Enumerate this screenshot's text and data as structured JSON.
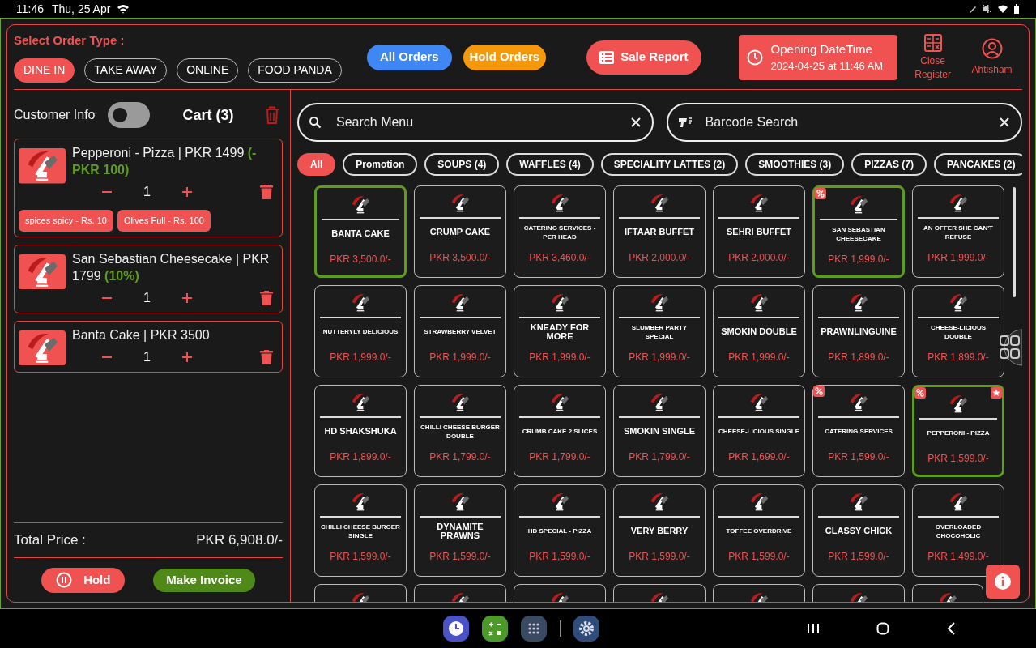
{
  "status_bar": {
    "time": "11:46",
    "date": "Thu, 25 Apr"
  },
  "header": {
    "order_type_label": "Select Order Type :",
    "order_types": [
      {
        "label": "DINE IN",
        "selected": true
      },
      {
        "label": "TAKE AWAY",
        "selected": false
      },
      {
        "label": "ONLINE",
        "selected": false
      },
      {
        "label": "FOOD PANDA",
        "selected": false
      }
    ],
    "all_orders": "All Orders",
    "hold_orders": "Hold Orders",
    "sale_report": "Sale Report",
    "opening": {
      "title": "Opening DateTime",
      "value": "2024-04-25 at 11:46 AM"
    },
    "close_register": "Close Register",
    "user": "Ahtisham"
  },
  "cart": {
    "customer_info": "Customer Info",
    "customer_info_on": false,
    "title": "Cart (3)",
    "items": [
      {
        "name": "Pepperoni - Pizza | PKR 1499",
        "discount": "(- PKR 100)",
        "qty": "1",
        "addons": [
          "spices spicy - Rs. 10",
          "Olives Full - Rs. 100"
        ]
      },
      {
        "name": "San Sebastian Cheesecake | PKR 1799",
        "discount": "(10%)",
        "qty": "1"
      },
      {
        "name": "Banta Cake | PKR 3500",
        "qty": "1"
      }
    ],
    "total_label": "Total Price :",
    "total": "PKR 6,908.0/-",
    "hold": "Hold",
    "invoice": "Make Invoice"
  },
  "menu": {
    "search_placeholder": "Search Menu",
    "barcode_placeholder": "Barcode Search",
    "categories": [
      {
        "label": "All",
        "selected": true
      },
      {
        "label": "Promotion",
        "selected": false
      },
      {
        "label": "SOUPS (4)",
        "selected": false
      },
      {
        "label": "WAFFLES (4)",
        "selected": false
      },
      {
        "label": "SPECIALITY LATTES (2)",
        "selected": false
      },
      {
        "label": "SMOOTHIES (3)",
        "selected": false
      },
      {
        "label": "PIZZAS (7)",
        "selected": false
      },
      {
        "label": "PANCAKES (2)",
        "selected": false
      }
    ],
    "items": [
      {
        "name": "BANTA CAKE",
        "price": "PKR 3,500.0/-",
        "selected": true,
        "discount": false,
        "favorite": false
      },
      {
        "name": "CRUMP CAKE",
        "price": "PKR 3,500.0/-",
        "selected": false,
        "discount": false,
        "favorite": false
      },
      {
        "name": "CATERING SERVICES - PER HEAD",
        "price": "PKR 3,460.0/-",
        "selected": false,
        "discount": false,
        "favorite": false
      },
      {
        "name": "IFTAAR BUFFET",
        "price": "PKR 2,000.0/-",
        "selected": false,
        "discount": false,
        "favorite": false
      },
      {
        "name": "SEHRI BUFFET",
        "price": "PKR 2,000.0/-",
        "selected": false,
        "discount": false,
        "favorite": false
      },
      {
        "name": "SAN SEBASTIAN CHEESECAKE",
        "price": "PKR 1,999.0/-",
        "selected": true,
        "discount": true,
        "favorite": false
      },
      {
        "name": "AN OFFER SHE CAN'T REFUSE",
        "price": "PKR 1,999.0/-",
        "selected": false,
        "discount": false,
        "favorite": false
      },
      {
        "name": "NUTTERYLY DELICIOUS",
        "price": "PKR 1,999.0/-",
        "selected": false,
        "discount": false,
        "favorite": false
      },
      {
        "name": "STRAWBERRY VELVET",
        "price": "PKR 1,999.0/-",
        "selected": false,
        "discount": false,
        "favorite": false
      },
      {
        "name": "KNEADY FOR MORE",
        "price": "PKR 1,999.0/-",
        "selected": false,
        "discount": false,
        "favorite": false
      },
      {
        "name": "SLUMBER PARTY SPECIAL",
        "price": "PKR 1,999.0/-",
        "selected": false,
        "discount": false,
        "favorite": false
      },
      {
        "name": "SMOKIN DOUBLE",
        "price": "PKR 1,999.0/-",
        "selected": false,
        "discount": false,
        "favorite": false
      },
      {
        "name": "PRAWNLINGUINE",
        "price": "PKR 1,899.0/-",
        "selected": false,
        "discount": false,
        "favorite": false
      },
      {
        "name": "CHEESE-LICIOUS DOUBLE",
        "price": "PKR 1,899.0/-",
        "selected": false,
        "discount": false,
        "favorite": false
      },
      {
        "name": "HD SHAKSHUKA",
        "price": "PKR 1,899.0/-",
        "selected": false,
        "discount": false,
        "favorite": false
      },
      {
        "name": "CHILLI CHEESE BURGER DOUBLE",
        "price": "PKR 1,799.0/-",
        "selected": false,
        "discount": false,
        "favorite": false
      },
      {
        "name": "CRUMB CAKE 2 SLICES",
        "price": "PKR 1,799.0/-",
        "selected": false,
        "discount": false,
        "favorite": false
      },
      {
        "name": "SMOKIN SINGLE",
        "price": "PKR 1,799.0/-",
        "selected": false,
        "discount": false,
        "favorite": false
      },
      {
        "name": "CHEESE-LICIOUS SINGLE",
        "price": "PKR 1,699.0/-",
        "selected": false,
        "discount": false,
        "favorite": false
      },
      {
        "name": "CATERING SERVICES",
        "price": "PKR 1,599.0/-",
        "selected": false,
        "discount": true,
        "favorite": false
      },
      {
        "name": "PEPPERONI - PIZZA",
        "price": "PKR 1,599.0/-",
        "selected": true,
        "discount": true,
        "favorite": true
      },
      {
        "name": "CHILLI CHEESE BURGER SINGLE",
        "price": "PKR 1,599.0/-",
        "selected": false,
        "discount": false,
        "favorite": false
      },
      {
        "name": "DYNAMITE PRAWNS",
        "price": "PKR 1,599.0/-",
        "selected": false,
        "discount": false,
        "favorite": false
      },
      {
        "name": "HD SPECIAL - PIZZA",
        "price": "PKR 1,599.0/-",
        "selected": false,
        "discount": false,
        "favorite": false
      },
      {
        "name": "VERY BERRY",
        "price": "PKR 1,599.0/-",
        "selected": false,
        "discount": false,
        "favorite": false
      },
      {
        "name": "TOFFEE OVERDRIVE",
        "price": "PKR 1,599.0/-",
        "selected": false,
        "discount": false,
        "favorite": false
      },
      {
        "name": "CLASSY CHICK",
        "price": "PKR 1,599.0/-",
        "selected": false,
        "discount": false,
        "favorite": false
      },
      {
        "name": "OVERLOADED CHOCOHOLIC",
        "price": "PKR 1,499.0/-",
        "selected": false,
        "discount": false,
        "favorite": false
      },
      {
        "kind": "partial"
      },
      {
        "kind": "partial"
      },
      {
        "kind": "partial"
      },
      {
        "kind": "partial"
      },
      {
        "kind": "partial"
      },
      {
        "kind": "partial"
      },
      {
        "kind": "partial"
      }
    ]
  }
}
